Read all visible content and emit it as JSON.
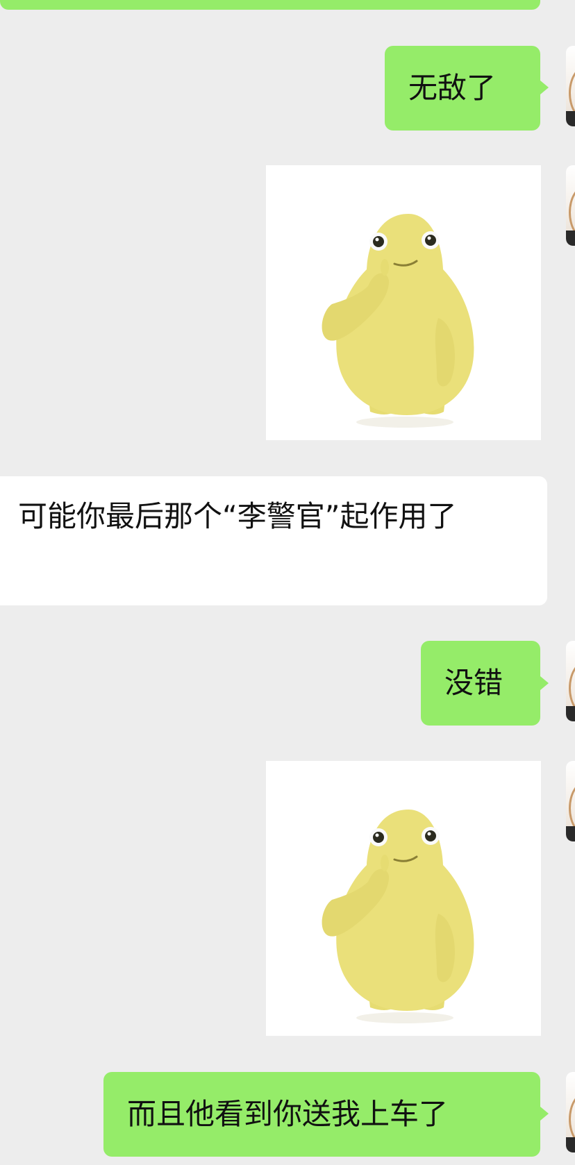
{
  "chat": {
    "messages": [
      {
        "side": "right",
        "type": "text",
        "text": "无敌了"
      },
      {
        "side": "right",
        "type": "sticker",
        "sticker": "yellow-blob-thinking"
      },
      {
        "side": "left",
        "type": "text",
        "text": "可能你最后那个“李警官”起作用了"
      },
      {
        "side": "right",
        "type": "text",
        "text": "没错"
      },
      {
        "side": "right",
        "type": "sticker",
        "sticker": "yellow-blob-thinking"
      },
      {
        "side": "right",
        "type": "text",
        "text": "而且他看到你送我上车了"
      }
    ]
  },
  "colors": {
    "background": "#ededed",
    "my_bubble": "#95ec69",
    "their_bubble": "#ffffff",
    "sticker_character": "#eae07a"
  },
  "icons": {
    "avatar": "user-avatar"
  }
}
